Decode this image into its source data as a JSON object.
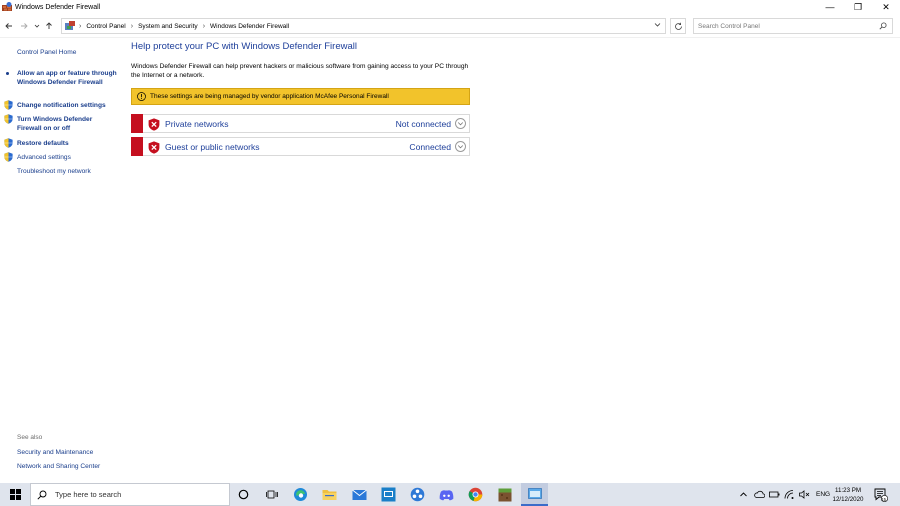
{
  "window": {
    "title": "Windows Defender Firewall",
    "controls": {
      "minimize": "—",
      "restore": "❐",
      "close": "✕"
    }
  },
  "address": {
    "breadcrumbs": [
      "Control Panel",
      "System and Security",
      "Windows Defender Firewall"
    ],
    "search_placeholder": "Search Control Panel"
  },
  "leftnav": {
    "home": "Control Panel Home",
    "allow_app": "Allow an app or feature through Windows Defender Firewall",
    "change_notifications": "Change notification settings",
    "turn_on_off": "Turn Windows Defender Firewall on or off",
    "restore_defaults": "Restore defaults",
    "advanced_settings": "Advanced settings",
    "troubleshoot": "Troubleshoot my network",
    "see_also_label": "See also",
    "see_also_security": "Security and Maintenance",
    "see_also_network": "Network and Sharing Center"
  },
  "main": {
    "title": "Help protect your PC with Windows Defender Firewall",
    "description": "Windows Defender Firewall can help prevent hackers or malicious software from gaining access to your PC through the Internet or a network.",
    "warning": "These settings are being managed by vendor application McAfee  Personal Firewall",
    "networks": [
      {
        "name": "Private networks",
        "status": "Not connected"
      },
      {
        "name": "Guest or public networks",
        "status": "Connected"
      }
    ]
  },
  "taskbar": {
    "search_text": "Type here to search",
    "language": "ENG",
    "time": "11:23 PM",
    "date": "12/12/2020",
    "notification_count": "15"
  },
  "colors": {
    "link": "#1e3f9a",
    "warning_bg": "#f2c32b",
    "alert_red": "#c50f1f",
    "taskbar_bg": "#dfe4ed"
  }
}
